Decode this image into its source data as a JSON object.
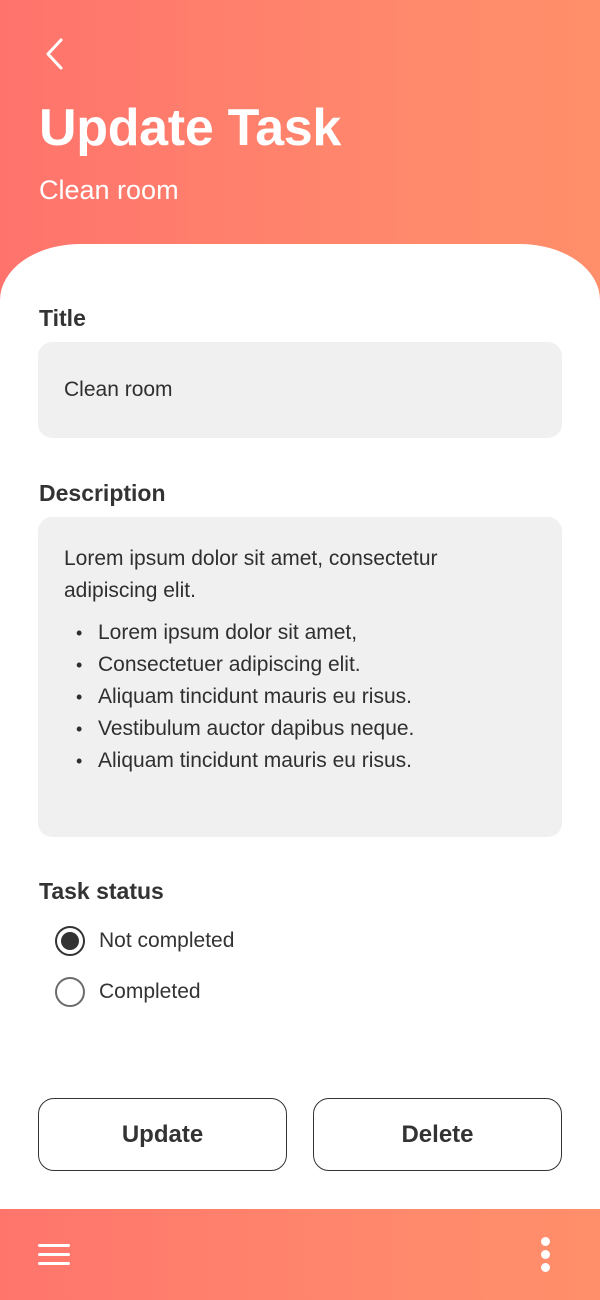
{
  "header": {
    "back_icon": "chevron-left-icon",
    "title": "Update Task",
    "subtitle": "Clean room"
  },
  "form": {
    "title_label": "Title",
    "title_value": "Clean room",
    "description_label": "Description",
    "description_intro": "Lorem ipsum dolor sit amet, consectetur adipiscing elit.",
    "description_items": [
      "Lorem ipsum dolor sit amet,",
      "Consectetuer adipiscing elit.",
      "Aliquam tincidunt mauris eu risus.",
      "Vestibulum auctor dapibus neque.",
      "Aliquam tincidunt mauris eu risus."
    ],
    "status_label": "Task status",
    "status_options": [
      {
        "label": "Not completed",
        "selected": true
      },
      {
        "label": "Completed",
        "selected": false
      }
    ]
  },
  "actions": {
    "update_label": "Update",
    "delete_label": "Delete"
  },
  "bottom_bar": {
    "menu_icon": "hamburger-menu-icon",
    "more_icon": "more-vertical-icon"
  },
  "colors": {
    "gradient_start": "#ff736c",
    "gradient_end": "#ff8e6a",
    "field_bg": "#f0f0f0",
    "text_dark": "#333333"
  }
}
